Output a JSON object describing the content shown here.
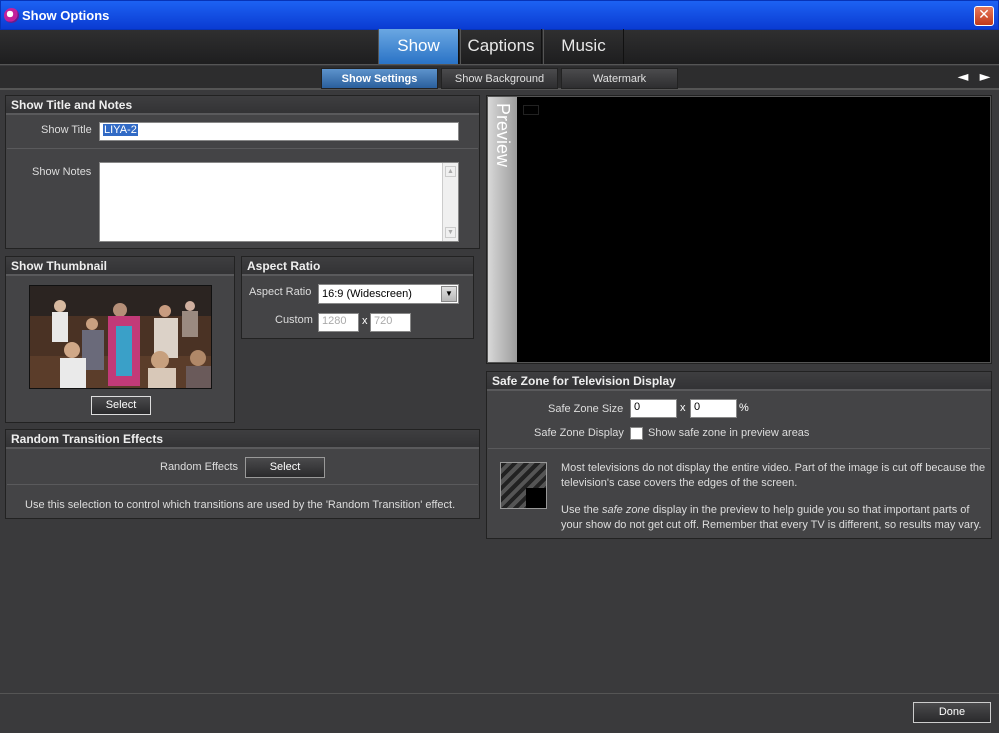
{
  "window": {
    "title": "Show Options",
    "close": "✕"
  },
  "main_tabs": [
    {
      "label": "Show"
    },
    {
      "label": "Captions"
    },
    {
      "label": "Music"
    }
  ],
  "sub_tabs": [
    {
      "label": "Show Settings"
    },
    {
      "label": "Show Background"
    },
    {
      "label": "Watermark"
    }
  ],
  "nav_arrows": {
    "back": "◄",
    "forward": "►"
  },
  "title_notes": {
    "heading": "Show Title and Notes",
    "title_label": "Show Title",
    "title_value": "LIYA-2",
    "notes_label": "Show Notes",
    "notes_value": ""
  },
  "thumbnail": {
    "heading": "Show Thumbnail",
    "select_label": "Select"
  },
  "aspect": {
    "heading": "Aspect Ratio",
    "ratio_label": "Aspect Ratio",
    "ratio_value": "16:9 (Widescreen)",
    "custom_label": "Custom",
    "width": "1280",
    "sep": "x",
    "height": "720"
  },
  "random": {
    "heading": "Random Transition Effects",
    "effects_label": "Random Effects",
    "select_label": "Select",
    "note": "Use this selection to control which transitions are used by the 'Random Transition' effect."
  },
  "preview": {
    "label": "Preview"
  },
  "safe_zone": {
    "heading": "Safe Zone for Television Display",
    "size_label": "Safe Zone Size",
    "size_x": "0",
    "sep": "x",
    "size_y": "0",
    "unit": "%",
    "display_label": "Safe Zone Display",
    "checkbox_label": "Show safe zone in preview areas",
    "info1": "Most televisions do not display the entire video. Part of the image is cut off because the television's case covers the edges of the screen.",
    "info2_a": "Use the ",
    "info2_em": "safe zone",
    "info2_b": " display in the preview to help guide you so that important parts of your show do not get cut off. Remember that every TV is different, so results may vary."
  },
  "footer": {
    "done_label": "Done"
  },
  "colors": {
    "titlebar": "#0a3bd2",
    "active_tab": "#2a73c6",
    "panel": "#444446",
    "preview_bg": "#000000"
  }
}
